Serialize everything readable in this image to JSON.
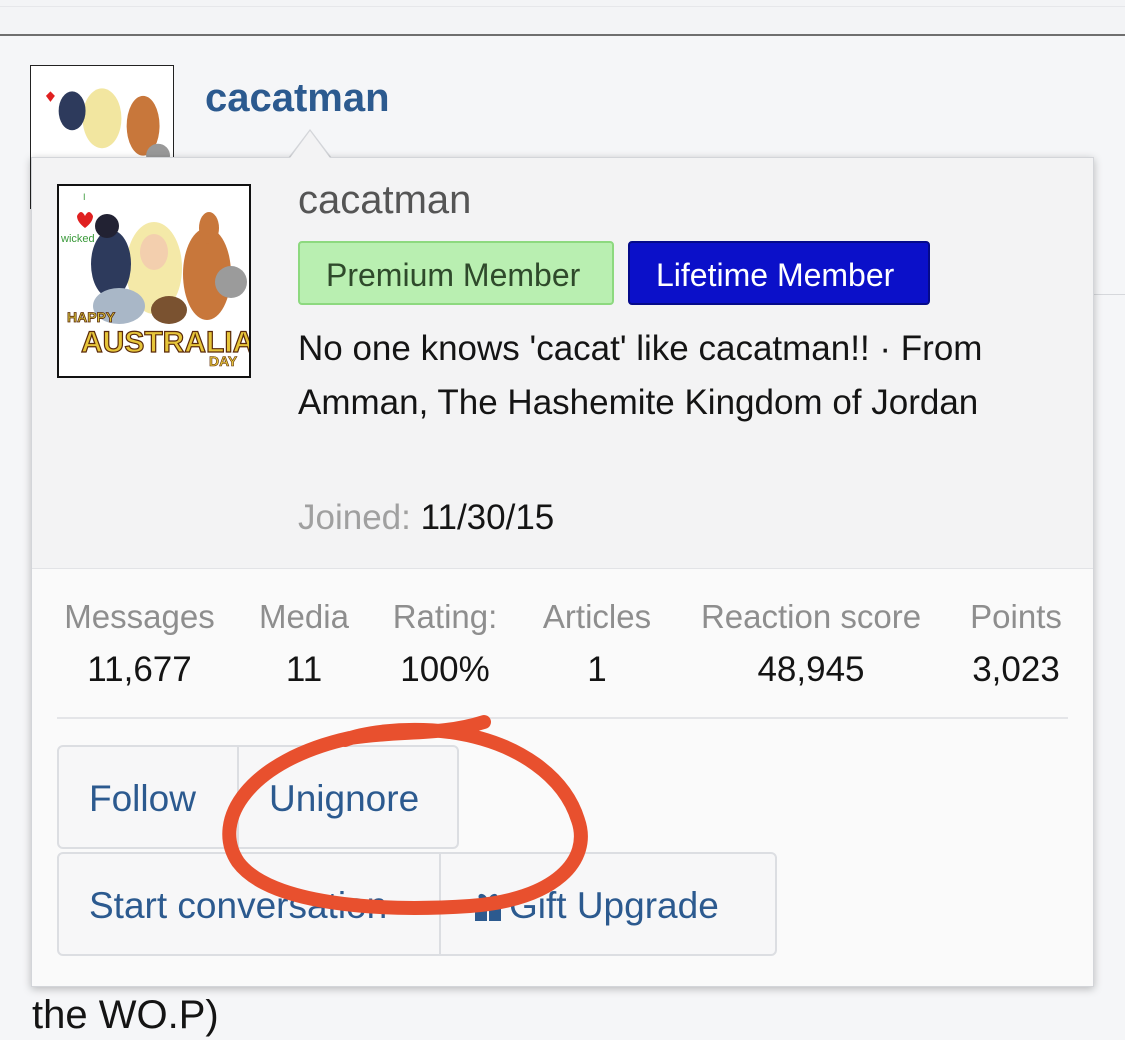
{
  "background": {
    "username": "cacatman",
    "trailing_text": "the WO.P)"
  },
  "card": {
    "username": "cacatman",
    "badges": {
      "premium": "Premium Member",
      "lifetime": "Lifetime Member"
    },
    "blurb": "No one knows 'cacat' like cacatman!! · From Amman, The Hashemite Kingdom of Jordan",
    "joined_label": "Joined:",
    "joined_value": "11/30/15",
    "avatar": {
      "label_i": "I",
      "label_wicked": "wicked",
      "label_happy": "HAPPY",
      "label_australia": "AUSTRALIA",
      "label_day": "DAY"
    },
    "stats": [
      {
        "label": "Messages",
        "value": "11,677"
      },
      {
        "label": "Media",
        "value": "11"
      },
      {
        "label": "Rating:",
        "value": "100%"
      },
      {
        "label": "Articles",
        "value": "1"
      },
      {
        "label": "Reaction score",
        "value": "48,945"
      },
      {
        "label": "Points",
        "value": "3,023"
      }
    ],
    "buttons": {
      "follow": "Follow",
      "unignore": "Unignore",
      "start_conversation": "Start conversation",
      "gift_upgrade": "Gift Upgrade"
    }
  },
  "colors": {
    "link": "#2c5a8f",
    "premium_badge": "#b9efb1",
    "lifetime_badge": "#0b10c9",
    "annotation": "#e8502e"
  },
  "icons": [
    "gift-icon",
    "avatar-image"
  ]
}
